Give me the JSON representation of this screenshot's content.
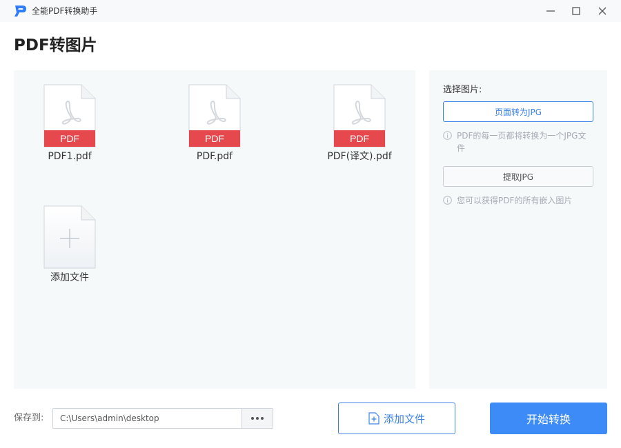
{
  "window": {
    "title": "全能PDF转换助手",
    "icons": {
      "logo": "app-logo-p",
      "minimize": "minimize-icon",
      "maximize": "maximize-icon",
      "close": "close-icon"
    }
  },
  "page": {
    "title": "PDF转图片"
  },
  "files": [
    {
      "name": "PDF1.pdf",
      "badge": "PDF"
    },
    {
      "name": "PDF.pdf",
      "badge": "PDF"
    },
    {
      "name": "PDF(译文).pdf",
      "badge": "PDF"
    }
  ],
  "add_file_tile": {
    "label": "添加文件"
  },
  "options": {
    "label": "选择图片:",
    "page_to_jpg": "页面转为JPG",
    "page_to_jpg_hint": "PDF的每一页都将转换为一个JPG文件",
    "extract_jpg": "提取JPG",
    "extract_jpg_hint": "您可以获得PDF的所有嵌入图片"
  },
  "bottom": {
    "save_label": "保存到:",
    "save_path": "C:\\Users\\admin\\desktop",
    "browse_label": "•••",
    "add_file_button": "添加文件",
    "start_button": "开始转换"
  },
  "colors": {
    "accent": "#3d8bf7",
    "pdf_badge": "#e5494d",
    "panel_bg": "#f6f9fa"
  }
}
